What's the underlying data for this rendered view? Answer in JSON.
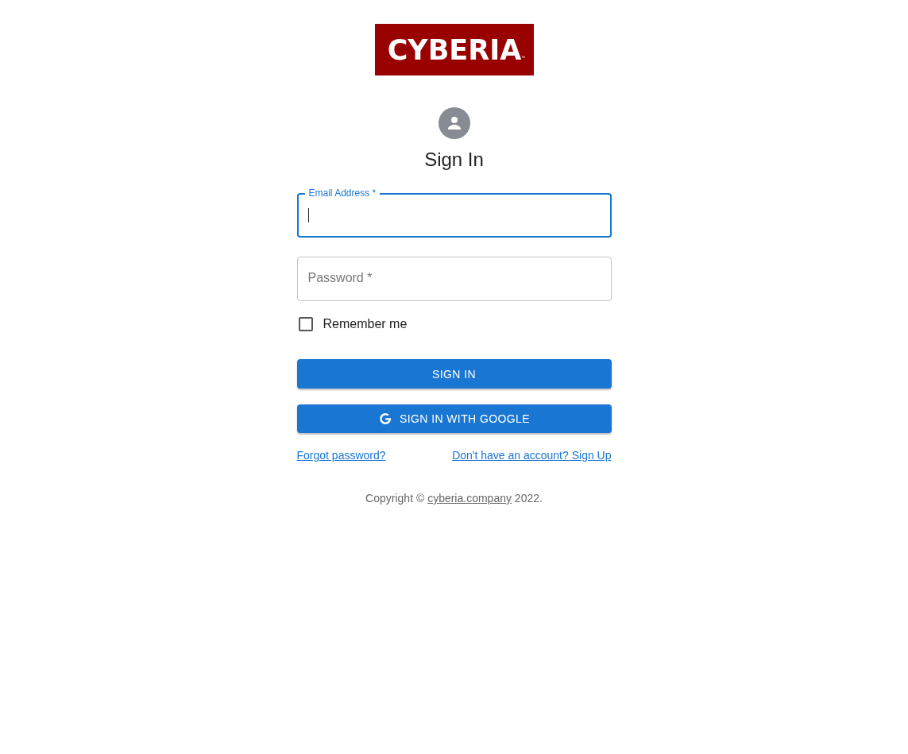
{
  "logo": {
    "text": "CYBERIA",
    "mark": "™"
  },
  "title": "Sign In",
  "fields": [
    {
      "label": "Email Address *",
      "focused": true
    },
    {
      "label": "Password *",
      "focused": false
    }
  ],
  "remember": {
    "label": "Remember me",
    "checked": false
  },
  "buttons": [
    {
      "kind": "primary",
      "label": "SIGN IN"
    },
    {
      "kind": "google",
      "label": "SIGN IN WITH GOOGLE"
    }
  ],
  "links": [
    "Forgot password?",
    "Don't have an account? Sign Up"
  ],
  "copyright": {
    "before": "Copyright ©",
    "link": "cyberia.company",
    "after": "2022."
  }
}
